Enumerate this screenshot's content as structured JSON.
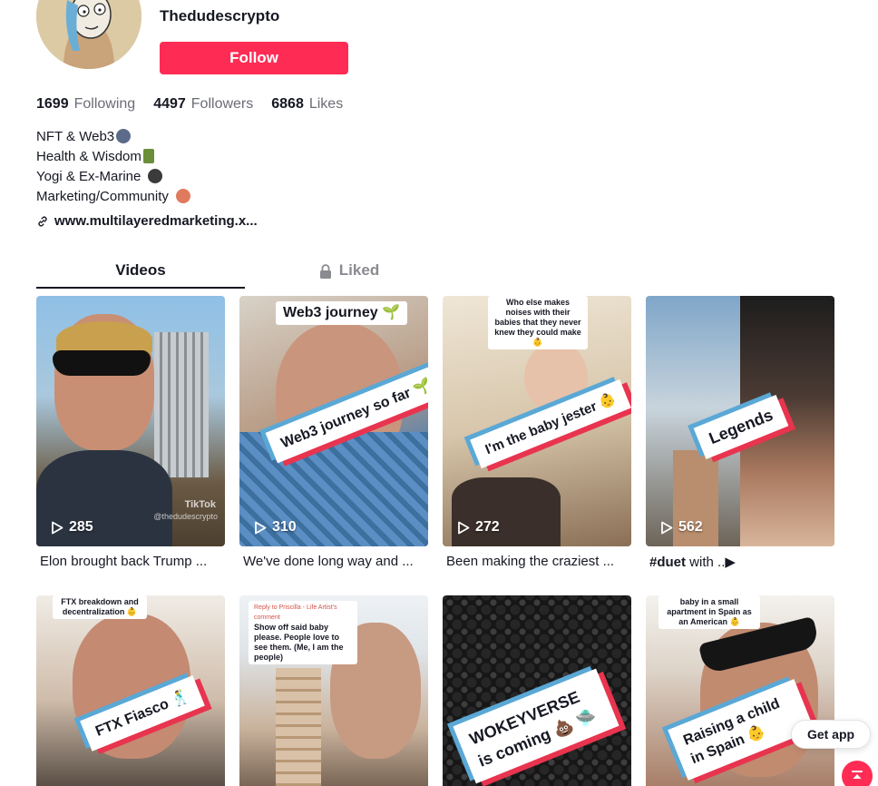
{
  "profile": {
    "username": "Thedudescrypto",
    "follow_label": "Follow",
    "stats": [
      {
        "value": "1699",
        "label": "Following"
      },
      {
        "value": "4497",
        "label": "Followers"
      },
      {
        "value": "6868",
        "label": "Likes"
      }
    ],
    "bio": [
      "NFT & Web3",
      "Health & Wisdom",
      "Yogi & Ex-Marine",
      "Marketing/Community"
    ],
    "link": "www.multilayeredmarketing.x..."
  },
  "tabs": [
    {
      "label": "Videos",
      "active": true
    },
    {
      "label": "Liked",
      "active": false,
      "icon": "lock-icon"
    }
  ],
  "videos": [
    {
      "views": "285",
      "caption": "Elon brought back Trump ...",
      "watermark": "TikTok",
      "watermark_user": "@thedudescrypto"
    },
    {
      "views": "310",
      "caption": "We've done long way and ...",
      "sticker": "Web3 journey 🌱",
      "tag": "Web3 journey so far 🌱"
    },
    {
      "views": "272",
      "caption": "Been making the craziest ...",
      "sticker": "Who else makes noises with their babies that they never knew they could make 👶",
      "tag": "I'm the baby jester 👶"
    },
    {
      "views": "562",
      "caption_bold": "#duet",
      "caption": " with ..▶",
      "tag": "Legends"
    },
    {
      "sticker": "FTX breakdown and decentralization 👶",
      "tag": "FTX Fiasco 🕺"
    },
    {
      "sticker_header": "Reply to Priscilla - Life Artist's comment",
      "sticker": "Show off said baby please. People love to see them. (Me, I am the people)"
    },
    {
      "tag": "WOKEYVERSE is coming 💩 🛸"
    },
    {
      "sticker": "baby in a small apartment in Spain as an American 👶",
      "tag": "Raising a child in Spain 👶"
    }
  ],
  "get_app_label": "Get app",
  "colors": {
    "accent": "#fe2c55",
    "text": "#161823",
    "muted": "#8a8b91"
  }
}
